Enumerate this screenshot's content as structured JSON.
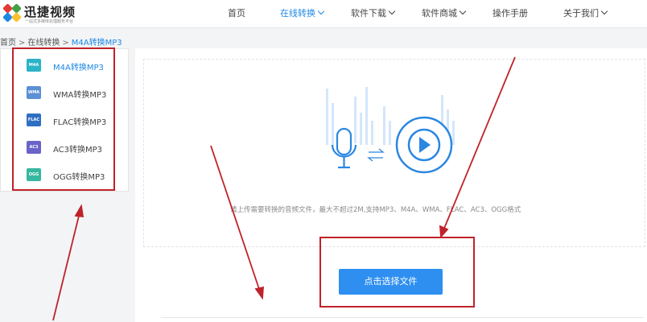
{
  "header": {
    "logo_title": "迅捷视频",
    "logo_subtitle": "一站式多媒体处理服务平台",
    "nav": [
      {
        "label": "首页",
        "active": false,
        "dropdown": false
      },
      {
        "label": "在线转换",
        "active": true,
        "dropdown": true
      },
      {
        "label": "软件下载",
        "active": false,
        "dropdown": true
      },
      {
        "label": "软件商城",
        "active": false,
        "dropdown": true
      },
      {
        "label": "操作手册",
        "active": false,
        "dropdown": false
      },
      {
        "label": "关于我们",
        "active": false,
        "dropdown": true
      }
    ]
  },
  "breadcrumb": {
    "home": "首页",
    "separator": ">",
    "section": "在线转换",
    "current": "M4A转换MP3"
  },
  "sidebar": {
    "items": [
      {
        "label": "M4A转换MP3",
        "icon_text": "M4A",
        "active": true
      },
      {
        "label": "WMA转换MP3",
        "icon_text": "WMA",
        "active": false
      },
      {
        "label": "FLAC转换MP3",
        "icon_text": "FLAC",
        "active": false
      },
      {
        "label": "AC3转换MP3",
        "icon_text": "AC3",
        "active": false
      },
      {
        "label": "OGG转换MP3",
        "icon_text": "OGG",
        "active": false
      }
    ]
  },
  "upload": {
    "hint": "请上传需要转换的音频文件，最大不超过2M,支持MP3、M4A、WMA、FLAC、AC3、OGG格式",
    "button_label": "点击选择文件"
  },
  "colors": {
    "accent": "#1e88e5",
    "button": "#2e8ff0",
    "annotation_red": "#c0222a"
  },
  "icons": {
    "microphone": "microphone-icon",
    "play": "play-icon",
    "swap": "swap-arrows-icon"
  }
}
